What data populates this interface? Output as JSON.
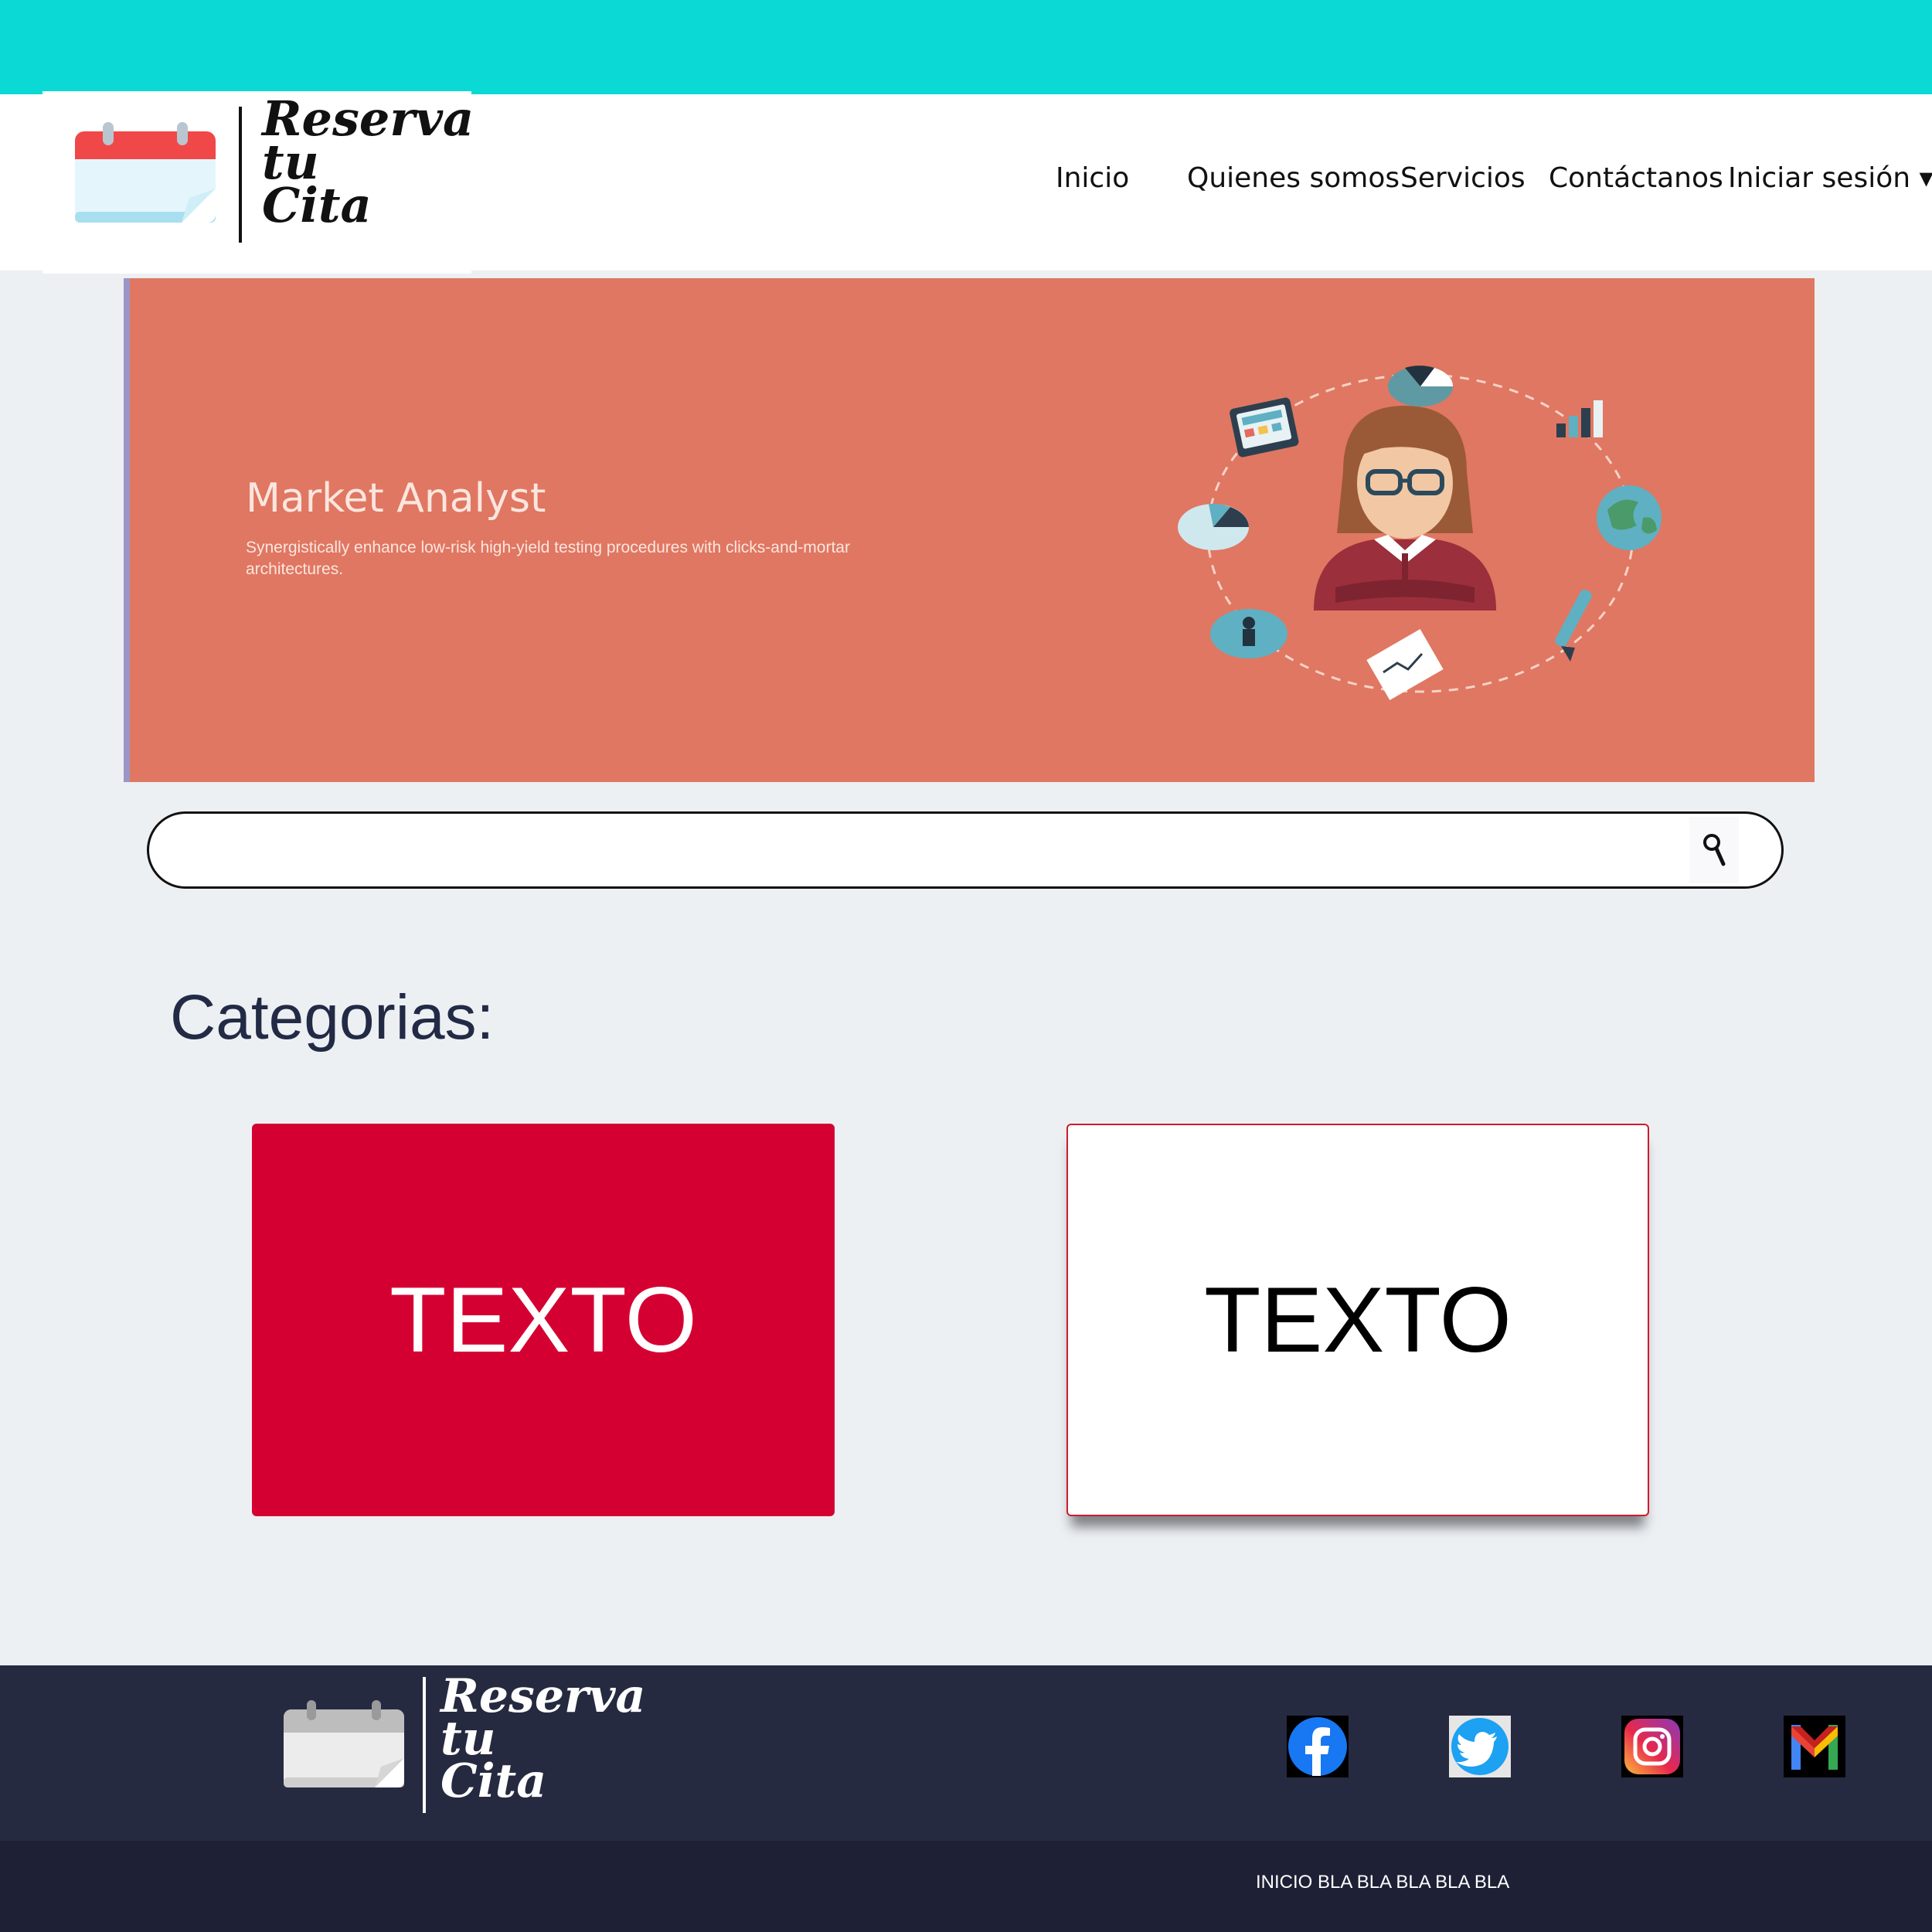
{
  "brand": {
    "line1": "Reserva",
    "line2": "tu",
    "line3": "Cita"
  },
  "nav": {
    "items": [
      {
        "label": "Inicio"
      },
      {
        "label": "Quienes somos"
      },
      {
        "label": "Servicios"
      },
      {
        "label": "Contáctanos"
      },
      {
        "label": "Iniciar sesión ▾"
      }
    ]
  },
  "hero": {
    "title": "Market Analyst",
    "subtitle": "Synergistically enhance low-risk high-yield testing procedures with clicks-and-mortar architectures."
  },
  "search": {
    "value": "",
    "icon": "search-icon"
  },
  "categories": {
    "title": "Categorias:",
    "cards": [
      {
        "label": "TEXTO",
        "color": "#d50032"
      },
      {
        "label": "TEXTO",
        "color": "#ffffff"
      }
    ]
  },
  "footer": {
    "social": [
      "facebook-icon",
      "twitter-icon",
      "instagram-icon",
      "gmail-icon"
    ],
    "bottom_text": "INICIO BLA BLA BLA BLA BLA"
  },
  "colors": {
    "topbar": "#0bd9d6",
    "hero": "#e07762",
    "card_accent": "#d50032",
    "footer": "#262a40"
  }
}
